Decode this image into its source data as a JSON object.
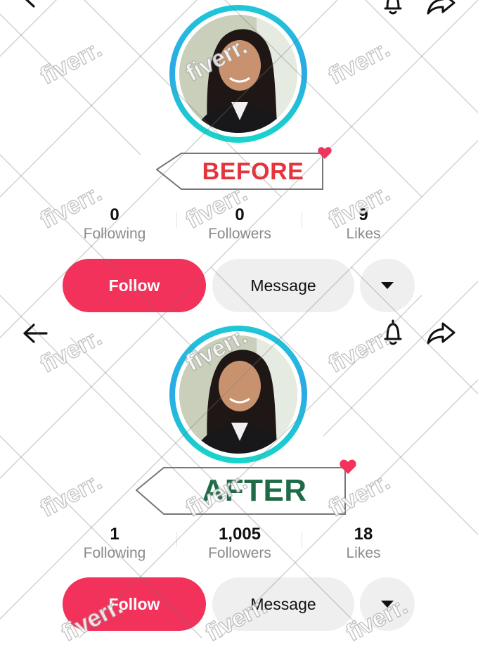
{
  "colors": {
    "follow_bg": "#f2325a",
    "before_label": "#e5343c",
    "after_label": "#1f6b47",
    "heart": "#f2325a",
    "ring": "#1ec8d6"
  },
  "icons": {
    "back": "arrow-left-icon",
    "notifications": "bell-icon",
    "share": "share-icon",
    "more": "caret-down-icon"
  },
  "before": {
    "label": "BEFORE",
    "stats": [
      {
        "value": "0",
        "label": "Following"
      },
      {
        "value": "0",
        "label": "Followers"
      },
      {
        "value": "9",
        "label": "Likes"
      }
    ],
    "buttons": {
      "follow": "Follow",
      "message": "Message"
    }
  },
  "after": {
    "label": "AFTER",
    "stats": [
      {
        "value": "1",
        "label": "Following"
      },
      {
        "value": "1,005",
        "label": "Followers"
      },
      {
        "value": "18",
        "label": "Likes"
      }
    ],
    "buttons": {
      "follow": "Follow",
      "message": "Message"
    }
  },
  "watermark": {
    "text": "fiverr."
  }
}
